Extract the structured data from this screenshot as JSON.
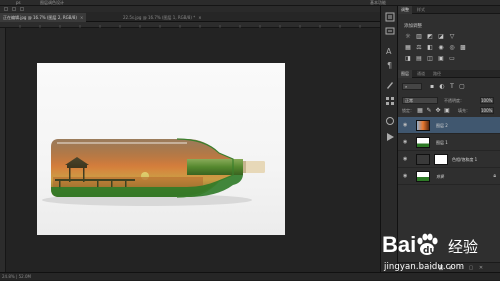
{
  "menubar": {
    "left_text": "ps",
    "doc_text": "图层调色设计",
    "right_text": "基本功能"
  },
  "tabs": [
    {
      "label": "正在编辑.jpg @ 16.7% (图层 2, RGB/8)",
      "active": true
    },
    {
      "label": "22.5s.jpg @ 16.7% (图层 1, RGB/8) *",
      "active": false
    }
  ],
  "status": {
    "text": "24.8% | 52.0M"
  },
  "panels": {
    "tabs": [
      {
        "label": "调整",
        "active": true
      },
      {
        "label": "样式",
        "active": false
      }
    ],
    "adjust_title": "添加调整",
    "layer_tabs": [
      {
        "label": "图层",
        "active": true
      },
      {
        "label": "通道",
        "active": false
      },
      {
        "label": "路径",
        "active": false
      }
    ],
    "blend_mode": "正常",
    "opacity_label": "不透明度：",
    "opacity_value": "100%",
    "lock_label": "锁定：",
    "fill_label": "填充：",
    "fill_value": "100%"
  },
  "layers": [
    {
      "name": "图层 2",
      "selected": true,
      "has_mask": false
    },
    {
      "name": "图层 1",
      "selected": false,
      "has_mask": false
    },
    {
      "name": "色相/饱和度 1",
      "selected": false,
      "has_mask": true
    },
    {
      "name": "背景",
      "selected": false,
      "has_mask": false,
      "locked": true
    }
  ],
  "watermark": {
    "brand": "Bai",
    "brand2": "经验",
    "url": "jingyan.baidu.com"
  },
  "colors": {
    "canvas_bg": "#232323",
    "panel_bg": "#2f2f2f",
    "selected_layer": "#40576f",
    "sunset_orange": "#e8722c"
  }
}
